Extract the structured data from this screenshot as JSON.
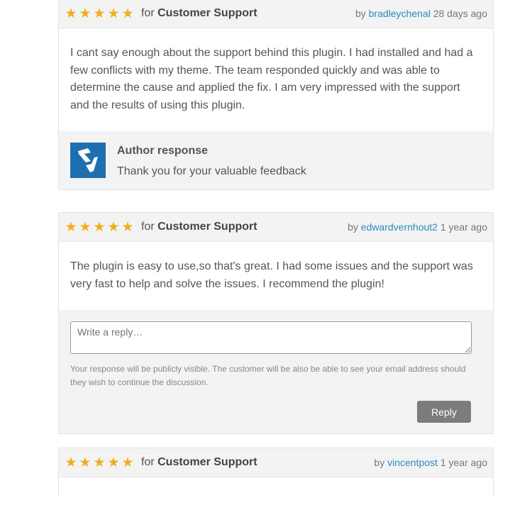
{
  "reviews": [
    {
      "rating": 5,
      "stars": "★★★★★",
      "for_prefix": "for",
      "category": "Customer Support",
      "by_prefix": "by",
      "author": "bradleychenal",
      "time": "28 days ago",
      "body": "I cant say enough about the support behind this plugin. I had installed and had a few conflicts with my theme. The team responded quickly and was able to determine the cause and applied the fix. I am very impressed with the support and the results of using this plugin.",
      "response": {
        "title": "Author response",
        "message": "Thank you for your valuable feedback"
      }
    },
    {
      "rating": 5,
      "stars": "★★★★★",
      "for_prefix": "for",
      "category": "Customer Support",
      "by_prefix": "by",
      "author": "edwardvernhout2",
      "time": "1 year ago",
      "body": "The plugin is easy to use,so that's great. I had some issues and the support was very fast to help and solve the issues. I recommend the plugin!",
      "reply": {
        "placeholder": "Write a reply…",
        "note": "Your response will be publicly visible. The customer will be also be able to see your email address should they wish to continue the discussion.",
        "button_label": "Reply"
      }
    },
    {
      "rating": 5,
      "stars": "★★★★★",
      "for_prefix": "for",
      "category": "Customer Support",
      "by_prefix": "by",
      "author": "vincentpost",
      "time": "1 year ago"
    }
  ],
  "colors": {
    "star": "#f0ad1e",
    "link": "#2a8bbf",
    "logo_bg": "#1d6fb0",
    "button_bg": "#7c7c7c"
  },
  "icons": {
    "logo": "brand-logo-icon",
    "star": "star-icon"
  }
}
